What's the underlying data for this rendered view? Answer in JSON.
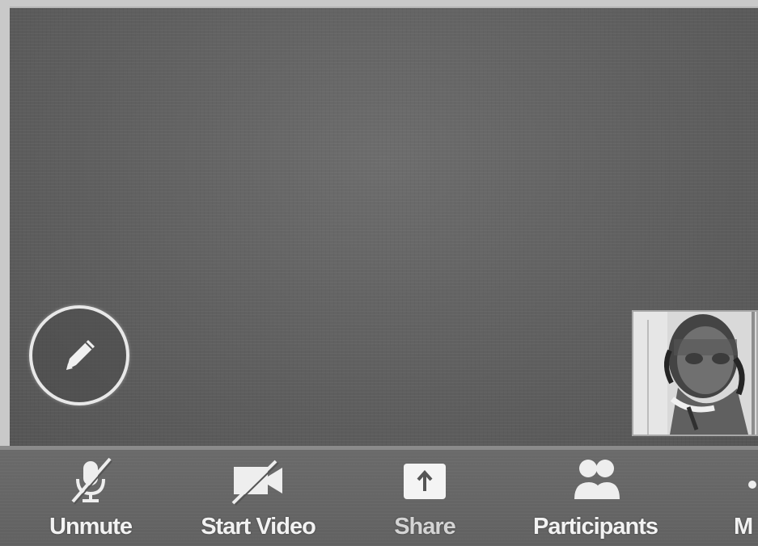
{
  "toolbar": {
    "unmute_label": "Unmute",
    "start_video_label": "Start Video",
    "share_label": "Share",
    "participants_label": "Participants",
    "more_label": "M"
  },
  "icons": {
    "annotate": "pencil-icon",
    "unmute": "microphone-muted-icon",
    "start_video": "video-camera-off-icon",
    "share": "share-up-arrow-icon",
    "participants": "participants-icon",
    "more": "more-dots-icon"
  },
  "colors": {
    "meeting_background": "#5f5f5f",
    "toolbar_background": "#616161",
    "label_text": "#f2f2f2",
    "share_icon_tile": "#f4f4f4"
  }
}
